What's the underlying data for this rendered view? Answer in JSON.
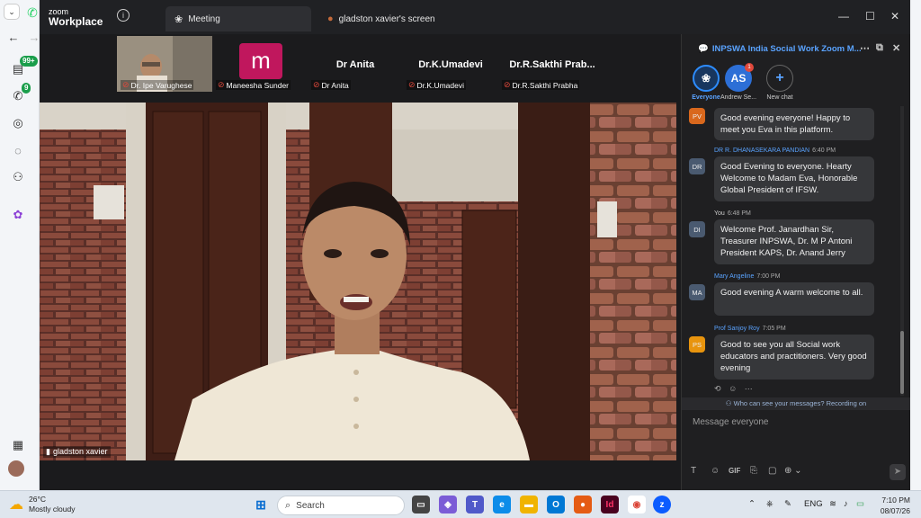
{
  "app": {
    "logo_line1": "zoom",
    "logo_line2": "Workplace",
    "tab_meeting": "Meeting",
    "tab_screen": "gladston xavier's screen"
  },
  "browser": {
    "badge_chat": "99+",
    "badge_calls": "9"
  },
  "thumbnails": [
    {
      "name": "Dr. Ipe Varughese",
      "display": ""
    },
    {
      "name": "Maneesha Sunder",
      "display": "m"
    },
    {
      "name": "Dr Anita",
      "display": "Dr Anita"
    },
    {
      "name": "Dr.K.Umadevi",
      "display": "Dr.K.Umadevi"
    },
    {
      "name": "Dr.R.Sakthi Prabha",
      "display": "Dr.R.Sakthi  Prab..."
    }
  ],
  "video": {
    "speaker_name": "gladston xavier"
  },
  "chat": {
    "title": "INPSWA India Social Work Zoom M...",
    "recipients": {
      "everyone": "Everyone",
      "as_initials": "AS",
      "as_label": "Andrew Se...",
      "as_badge": "1",
      "new_chat": "New chat"
    },
    "messages": [
      {
        "initials": "PV",
        "sender": "",
        "time": "",
        "text": "Good evening everyone! Happy to meet you Eva in this platform.",
        "color": "#d9681d"
      },
      {
        "initials": "DR",
        "sender": "DR R. DHANASEKARA PANDIAN",
        "time": "6:40 PM",
        "text": "Good Evening to everyone.  Hearty Welcome to Madam Eva, Honorable Global President of IFSW.",
        "color": "#4a5a70"
      },
      {
        "initials": "DI",
        "sender": "You",
        "time": "6:48 PM",
        "text": "Welcome Prof. Janardhan Sir, Treasurer INPSWA, Dr. M P Antoni President KAPS, Dr. Anand Jerry",
        "color": "#4a5a70"
      },
      {
        "initials": "MA",
        "sender": "Mary Angeline",
        "time": "7:00 PM",
        "text": "Good evening A warm welcome to all.",
        "color": "#4a5a70"
      },
      {
        "initials": "PS",
        "sender": "Prof Sanjoy Roy",
        "time": "7:05 PM",
        "text": "Good to see you all Social work educators and practitioners. Very good evening",
        "color": "#e8940e"
      }
    ],
    "privacy_note": "Who can see your messages? Recording on",
    "input_placeholder": "Message everyone",
    "toolbar_gif": "GIF"
  },
  "taskbar": {
    "temperature": "26°C",
    "weather": "Mostly cloudy",
    "search_label": "Search",
    "lang": "ENG",
    "time": "7:10 PM",
    "date": "08/07/26"
  }
}
